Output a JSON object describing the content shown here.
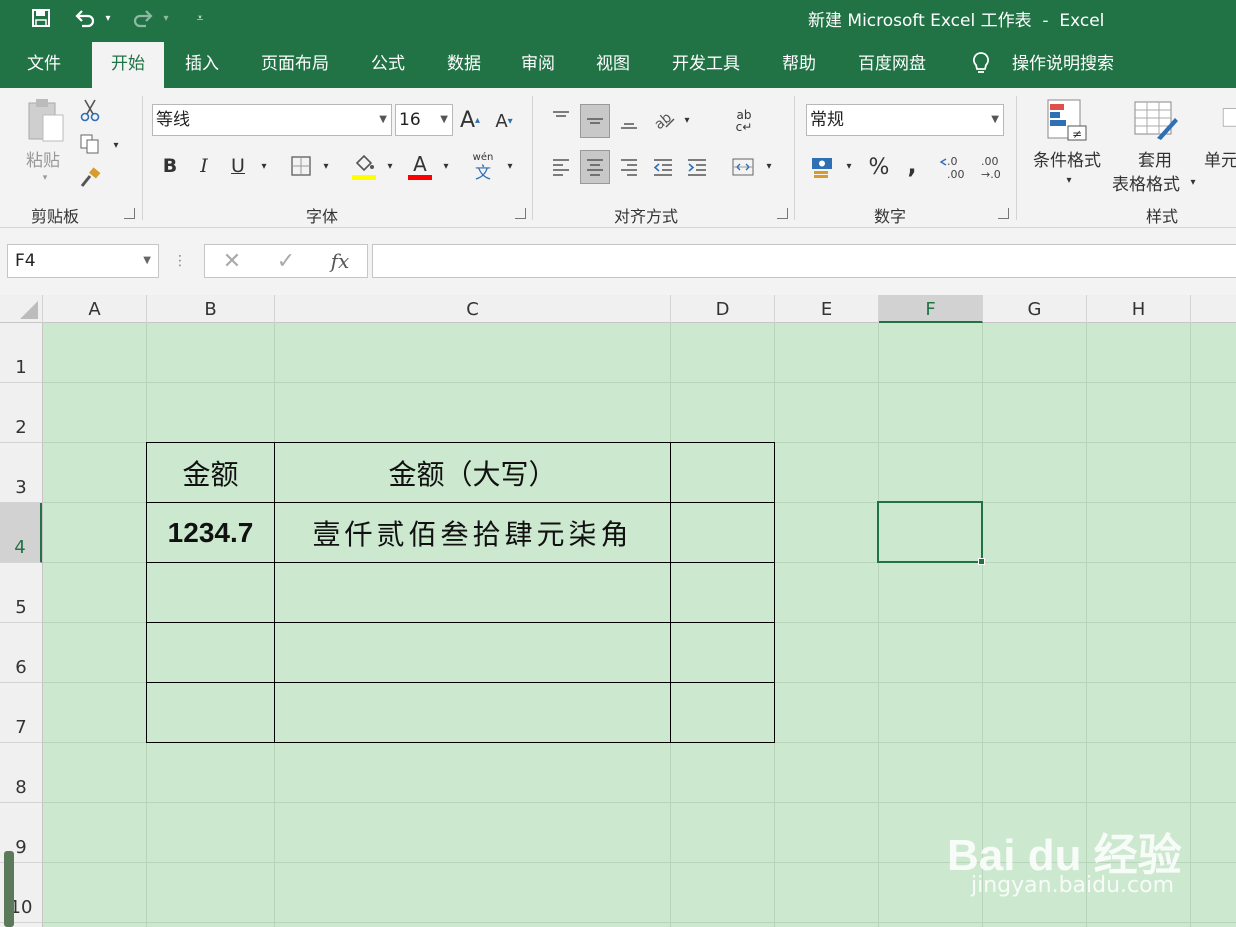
{
  "window": {
    "title": "新建 Microsoft Excel 工作表  -  Excel"
  },
  "tabs": [
    {
      "label": "文件"
    },
    {
      "label": "开始"
    },
    {
      "label": "插入"
    },
    {
      "label": "页面布局"
    },
    {
      "label": "公式"
    },
    {
      "label": "数据"
    },
    {
      "label": "审阅"
    },
    {
      "label": "视图"
    },
    {
      "label": "开发工具"
    },
    {
      "label": "帮助"
    },
    {
      "label": "百度网盘"
    },
    {
      "label": "操作说明搜索"
    }
  ],
  "ribbon": {
    "clipboard": {
      "paste": "粘贴",
      "label": "剪贴板"
    },
    "font": {
      "name": "等线",
      "size": "16",
      "label": "字体",
      "bold": "B",
      "italic": "I",
      "underline": "U",
      "phonetic_top": "wén",
      "phonetic_bottom": "文"
    },
    "alignment": {
      "label": "对齐方式",
      "wrap": "ab\nc↵"
    },
    "number": {
      "format": "常规",
      "label": "数字",
      "percent": "%",
      "comma": ","
    },
    "styles": {
      "conditional": "条件格式",
      "table_top": "套用",
      "table_bottom": "表格格式",
      "cell": "单元",
      "label": "样式"
    }
  },
  "formula_bar": {
    "name_box": "F4",
    "fx": "fx",
    "value": ""
  },
  "columns": [
    "A",
    "B",
    "C",
    "D",
    "E",
    "F",
    "G",
    "H"
  ],
  "rows": [
    "1",
    "2",
    "3",
    "4",
    "5",
    "6",
    "7",
    "8",
    "9",
    "10"
  ],
  "selected_cell": "F4",
  "table": {
    "header_b": "金额",
    "header_c": "金额（大写）",
    "value_b": "1234.7",
    "value_c": "壹仟贰佰叁拾肆元柒角"
  },
  "watermark": {
    "brand": "Bai du 经验",
    "url": "jingyan.baidu.com"
  },
  "colors": {
    "excel_green": "#217346",
    "sheet_bg": "#cce8cf"
  }
}
